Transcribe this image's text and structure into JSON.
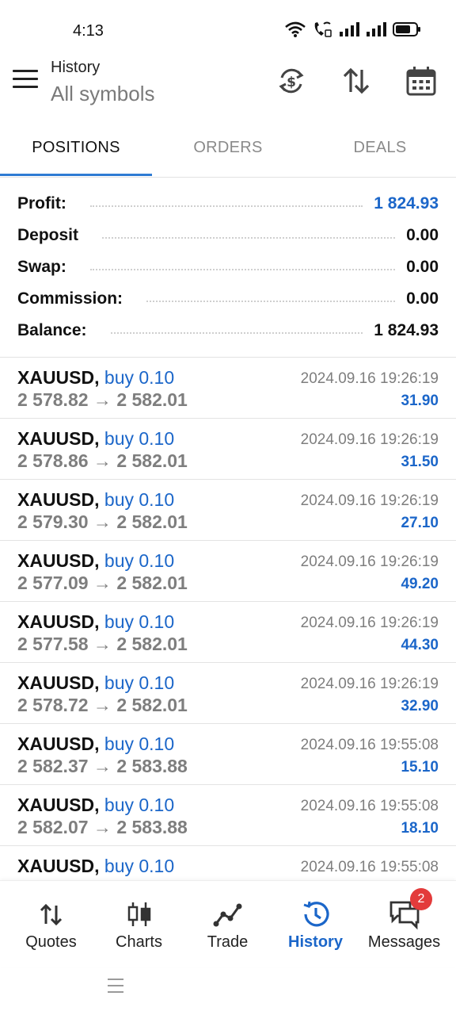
{
  "status_bar": {
    "time": "4:13",
    "icons": [
      "wifi-icon",
      "wifi-call-icon",
      "signal-icon",
      "signal-icon",
      "battery-icon"
    ]
  },
  "app_bar": {
    "title": "History",
    "subtitle": "All symbols",
    "actions": [
      "currency-exchange-icon",
      "sort-icon",
      "calendar-icon"
    ]
  },
  "tabs": [
    {
      "label": "POSITIONS",
      "active": true
    },
    {
      "label": "ORDERS",
      "active": false
    },
    {
      "label": "DEALS",
      "active": false
    }
  ],
  "summary": {
    "profit": {
      "label": "Profit:",
      "value": "1 824.93"
    },
    "deposit": {
      "label": "Deposit",
      "value": "0.00"
    },
    "swap": {
      "label": "Swap:",
      "value": "0.00"
    },
    "commission": {
      "label": "Commission:",
      "value": "0.00"
    },
    "balance": {
      "label": "Balance:",
      "value": "1 824.93"
    }
  },
  "deals": [
    {
      "symbol": "XAUUSD,",
      "type": "buy 0.10",
      "open": "2 578.82",
      "arrow": "→",
      "close": "2 582.01",
      "time": "2024.09.16 19:26:19",
      "profit": "31.90"
    },
    {
      "symbol": "XAUUSD,",
      "type": "buy 0.10",
      "open": "2 578.86",
      "arrow": "→",
      "close": "2 582.01",
      "time": "2024.09.16 19:26:19",
      "profit": "31.50"
    },
    {
      "symbol": "XAUUSD,",
      "type": "buy 0.10",
      "open": "2 579.30",
      "arrow": "→",
      "close": "2 582.01",
      "time": "2024.09.16 19:26:19",
      "profit": "27.10"
    },
    {
      "symbol": "XAUUSD,",
      "type": "buy 0.10",
      "open": "2 577.09",
      "arrow": "→",
      "close": "2 582.01",
      "time": "2024.09.16 19:26:19",
      "profit": "49.20"
    },
    {
      "symbol": "XAUUSD,",
      "type": "buy 0.10",
      "open": "2 577.58",
      "arrow": "→",
      "close": "2 582.01",
      "time": "2024.09.16 19:26:19",
      "profit": "44.30"
    },
    {
      "symbol": "XAUUSD,",
      "type": "buy 0.10",
      "open": "2 578.72",
      "arrow": "→",
      "close": "2 582.01",
      "time": "2024.09.16 19:26:19",
      "profit": "32.90"
    },
    {
      "symbol": "XAUUSD,",
      "type": "buy 0.10",
      "open": "2 582.37",
      "arrow": "→",
      "close": "2 583.88",
      "time": "2024.09.16 19:55:08",
      "profit": "15.10"
    },
    {
      "symbol": "XAUUSD,",
      "type": "buy 0.10",
      "open": "2 582.07",
      "arrow": "→",
      "close": "2 583.88",
      "time": "2024.09.16 19:55:08",
      "profit": "18.10"
    },
    {
      "symbol": "XAUUSD,",
      "type": "buy 0.10",
      "open": "",
      "arrow": "",
      "close": "",
      "time": "2024.09.16 19:55:08",
      "profit": ""
    }
  ],
  "bottom_nav": [
    {
      "label": "Quotes",
      "icon": "quotes-arrows-icon",
      "active": false
    },
    {
      "label": "Charts",
      "icon": "candlestick-icon",
      "active": false
    },
    {
      "label": "Trade",
      "icon": "trade-line-icon",
      "active": false
    },
    {
      "label": "History",
      "icon": "history-clock-icon",
      "active": true
    },
    {
      "label": "Messages",
      "icon": "messages-icon",
      "active": false
    }
  ],
  "messages_badge": "2",
  "colors": {
    "accent": "#1b66c9",
    "tab_indicator": "#2f7bd3",
    "badge": "#e33b3b",
    "muted": "#7e7e7e"
  }
}
